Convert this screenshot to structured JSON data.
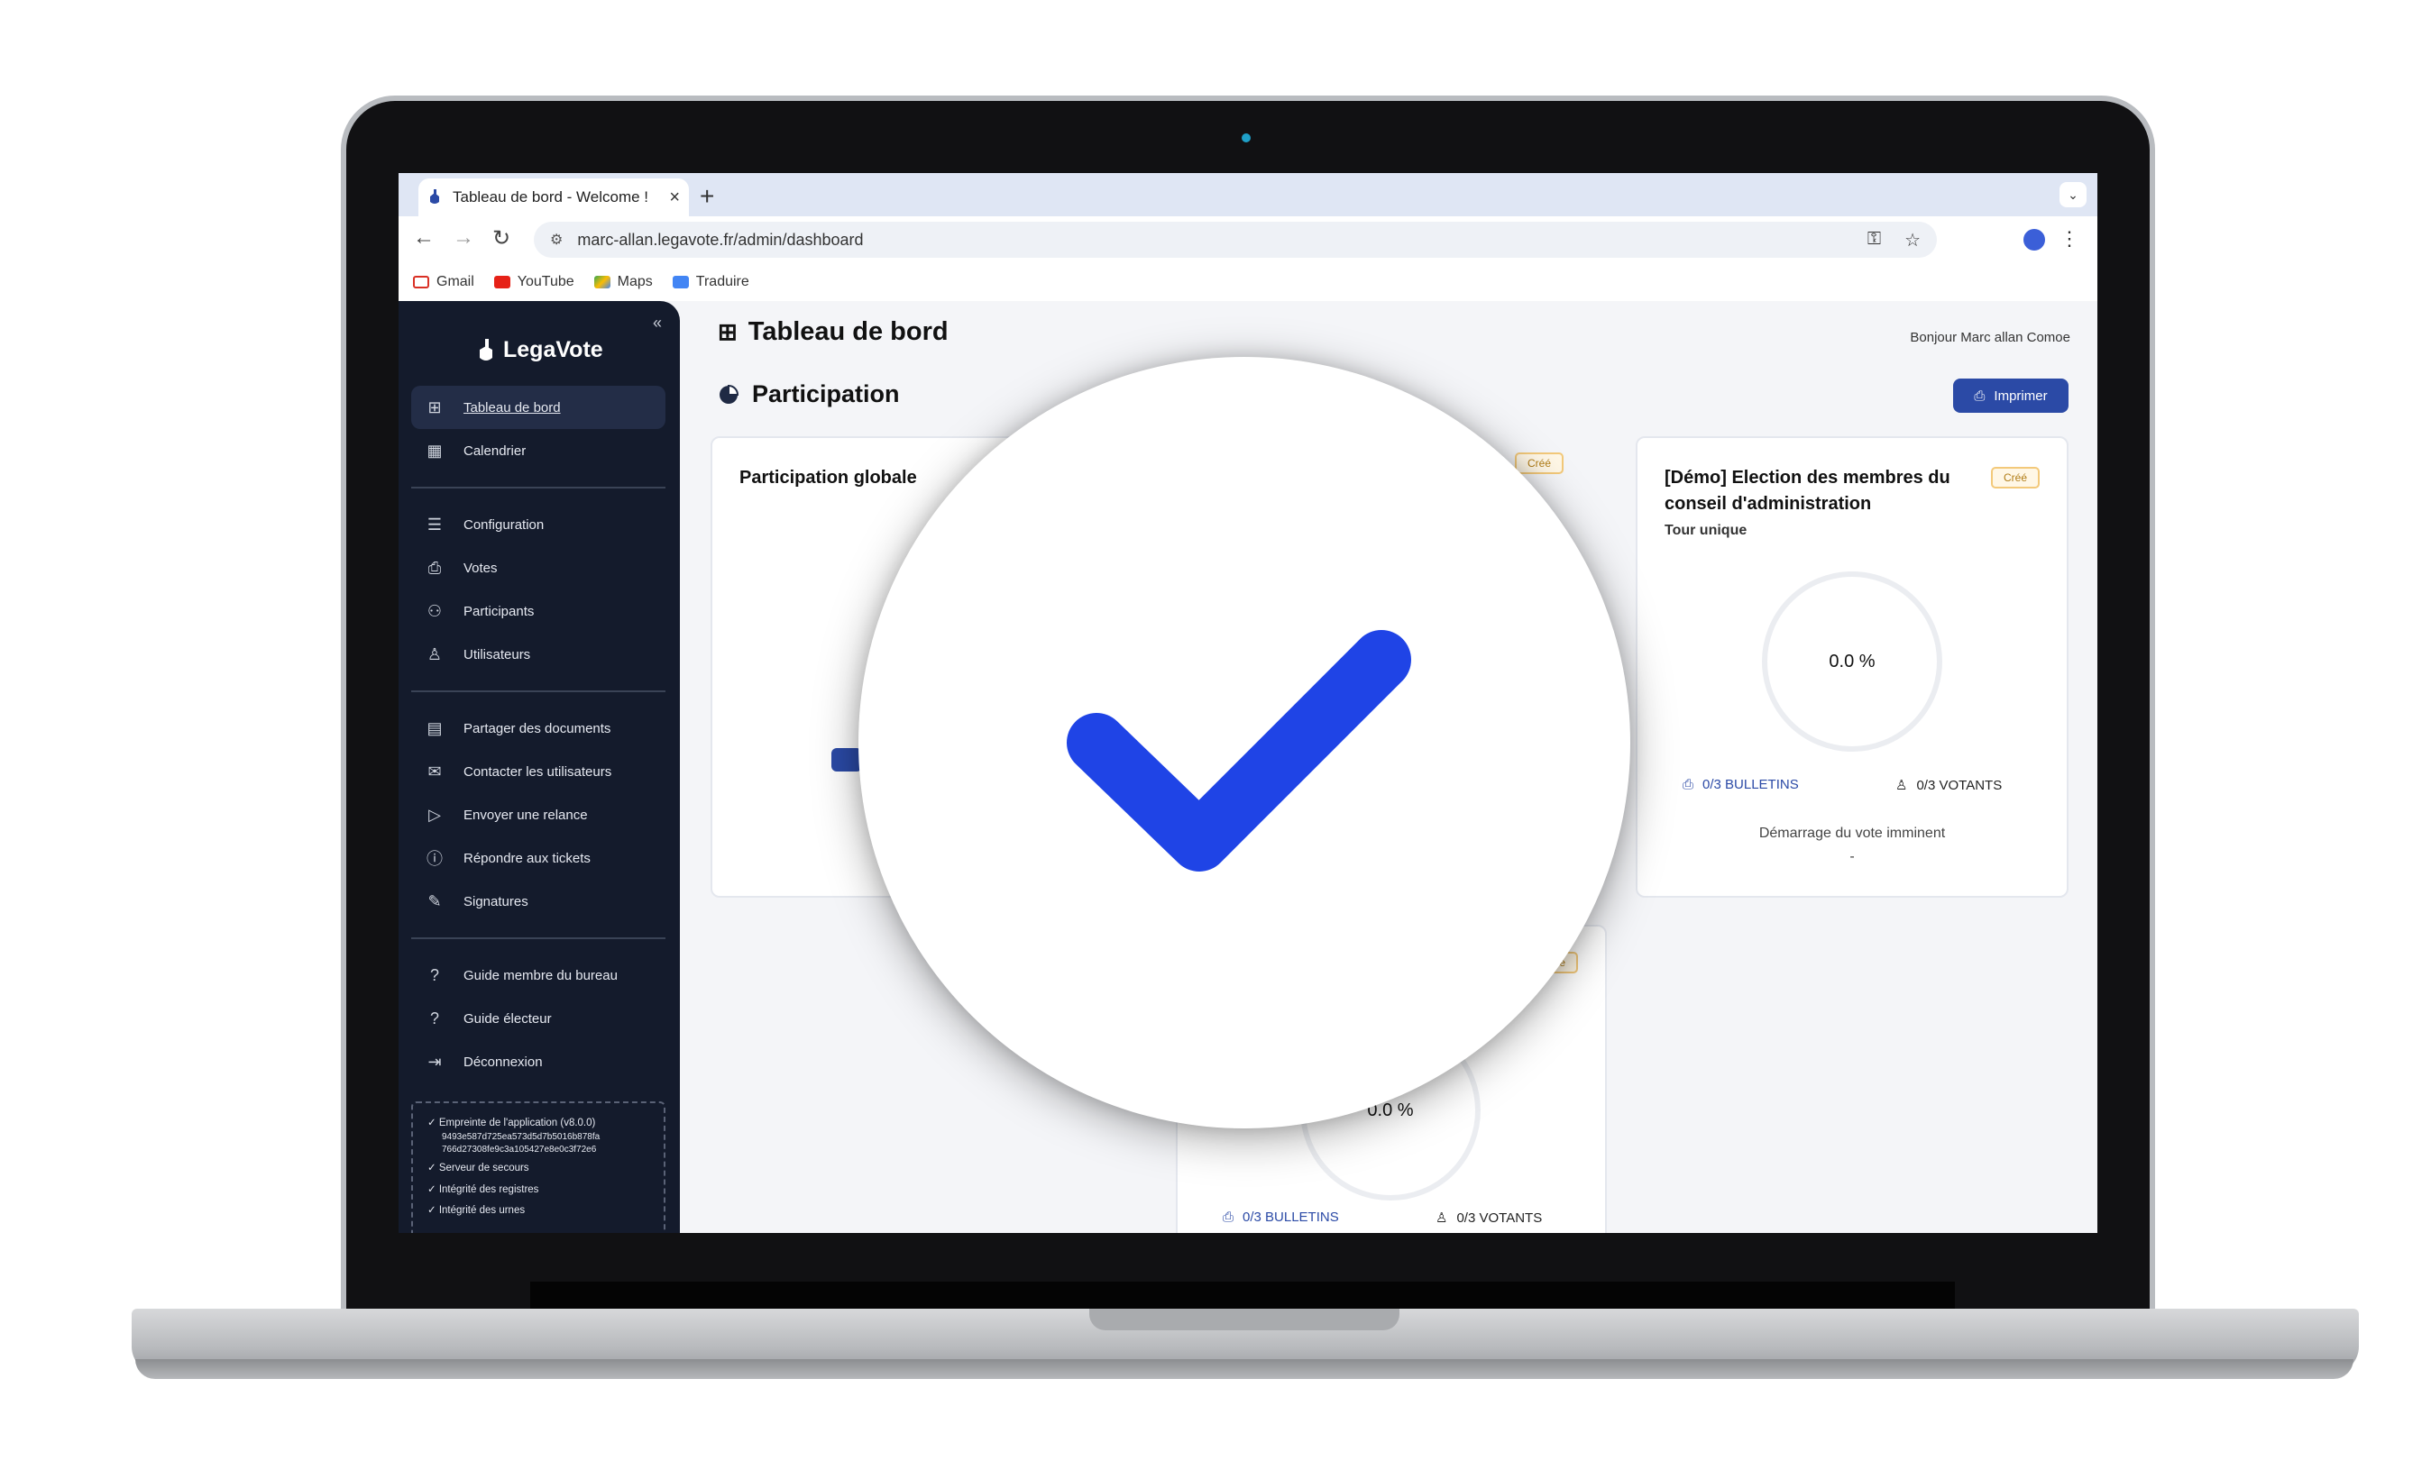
{
  "browser": {
    "tab_title": "Tableau de bord - Welcome !",
    "url": "marc-allan.legavote.fr/admin/dashboard",
    "bookmarks": [
      "Gmail",
      "YouTube",
      "Maps",
      "Traduire"
    ]
  },
  "sidebar": {
    "brand": "LegaVote",
    "items": [
      {
        "label": "Tableau de bord",
        "icon": "grid-icon"
      },
      {
        "label": "Calendrier",
        "icon": "calendar-icon"
      },
      {
        "label": "Configuration",
        "icon": "sliders-icon"
      },
      {
        "label": "Votes",
        "icon": "ballot-icon"
      },
      {
        "label": "Participants",
        "icon": "users-icon"
      },
      {
        "label": "Utilisateurs",
        "icon": "user-icon"
      },
      {
        "label": "Partager des documents",
        "icon": "document-icon"
      },
      {
        "label": "Contacter les utilisateurs",
        "icon": "mail-icon"
      },
      {
        "label": "Envoyer une relance",
        "icon": "send-icon"
      },
      {
        "label": "Répondre aux tickets",
        "icon": "alert-icon"
      },
      {
        "label": "Signatures",
        "icon": "pen-icon"
      },
      {
        "label": "Guide membre du bureau",
        "icon": "help-icon"
      },
      {
        "label": "Guide électeur",
        "icon": "help-icon"
      },
      {
        "label": "Déconnexion",
        "icon": "logout-icon"
      }
    ],
    "integrity": {
      "fingerprint": "Empreinte de l'application (v8.0.0)",
      "hash_line1": "9493e587d725ea573d5d7b5016b878fa",
      "hash_line2": "766d27308fe9c3a105427e8e0c3f72e6",
      "checks": [
        "Serveur de secours",
        "Intégrité des registres",
        "Intégrité des urnes"
      ]
    }
  },
  "header": {
    "title": "Tableau de bord",
    "greeting": "Bonjour Marc allan Comoe"
  },
  "participation": {
    "title": "Participation",
    "print_label": "Imprimer",
    "global_title": "Participation globale",
    "election": {
      "title": "[Démo] Election des membres du conseil d'administration",
      "badge": "Créé",
      "round": "Tour unique",
      "percent": "0.0 %",
      "bulletins": "0/3 BULLETINS",
      "votants": "0/3 VOTANTS",
      "status": "Démarrage du vote imminent",
      "status_sub": "-"
    },
    "partial_card": {
      "badge": "Créé",
      "percent": "0.0 %",
      "bulletins": "0/3 BULLETINS",
      "votants": "0/3 VOTANTS"
    }
  },
  "colors": {
    "sidebar_bg": "#141b2c",
    "accent": "#2b4aa6",
    "check": "#1f44e6",
    "badge": "#f3c97a"
  },
  "overlay": {
    "icon": "checkmark-icon"
  }
}
